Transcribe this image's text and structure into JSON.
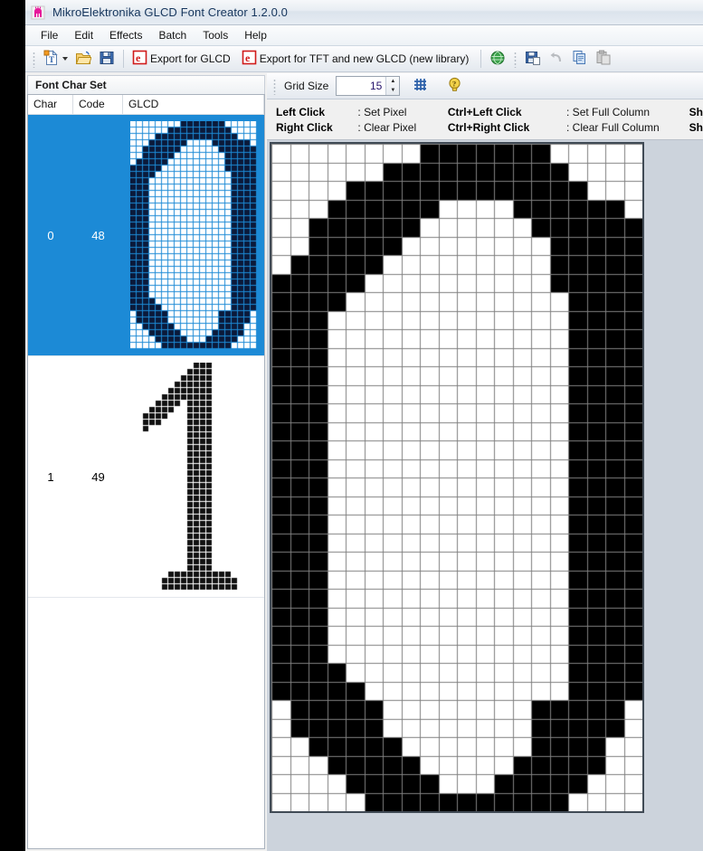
{
  "window": {
    "title": "MikroElektronika GLCD Font Creator 1.2.0.0",
    "app_icon": "app-logo-icon"
  },
  "menu": {
    "items": [
      {
        "label": "File"
      },
      {
        "label": "Edit"
      },
      {
        "label": "Effects"
      },
      {
        "label": "Batch"
      },
      {
        "label": "Tools"
      },
      {
        "label": "Help"
      }
    ]
  },
  "toolbar": {
    "new_label": "",
    "new_icon": "new-font-icon",
    "open_icon": "open-folder-icon",
    "save_icon": "save-disk-icon",
    "export_glcd_label": "Export for GLCD",
    "export_glcd_icon": "export-e-icon",
    "export_tft_label": "Export for TFT and new GLCD (new library)",
    "export_tft_icon": "export-e-icon",
    "web_icon": "globe-icon",
    "save_as_icon": "save-as-icon",
    "undo_icon": "undo-arrow-icon",
    "copy_icon": "copy-icon",
    "paste_icon": "paste-icon"
  },
  "left_panel": {
    "title": "Font Char Set",
    "columns": [
      "Char",
      "Code",
      "GLCD"
    ],
    "rows": [
      {
        "char": "0",
        "code": "48",
        "selected": true,
        "glyph": "zero"
      },
      {
        "char": "1",
        "code": "49",
        "selected": false,
        "glyph": "one"
      }
    ]
  },
  "grid_toolbar": {
    "label": "Grid Size",
    "value": "15",
    "spin_up_icon": "spinner-up-icon",
    "spin_down_icon": "spinner-down-icon",
    "toggle_grid_icon": "grid-toggle-icon",
    "help_icon": "help-bulb-icon"
  },
  "hints": {
    "rows": [
      {
        "key": "Left Click",
        "val": ": Set Pixel",
        "key2": "Ctrl+Left Click",
        "val2": ": Set Full Column",
        "key3": "Sh"
      },
      {
        "key": "Right Click",
        "val": ": Clear Pixel",
        "key2": "Ctrl+Right Click",
        "val2": ": Clear Full Column",
        "key3": "Sh"
      }
    ]
  },
  "editor": {
    "cols": 20,
    "rows": 36,
    "cell": 20.5,
    "on_color": "#000000",
    "off_color": "#ffffff",
    "line_color": "#808080",
    "border_color": "#404a55",
    "pixels": [
      "00000000111111100000",
      "00000011111111110000",
      "00001111111111111000",
      "00011111100001111110",
      "00111111000000111111",
      "00111110000000011111",
      "01111100000000011111",
      "11111000000000011111",
      "11110000000000001111",
      "11100000000000001111",
      "11100000000000001111",
      "11100000000000001111",
      "11100000000000001111",
      "11100000000000001111",
      "11100000000000001111",
      "11100000000000001111",
      "11100000000000001111",
      "11100000000000001111",
      "11100000000000001111",
      "11100000000000001111",
      "11100000000000001111",
      "11100000000000001111",
      "11100000000000001111",
      "11100000000000001111",
      "11100000000000001111",
      "11100000000000001111",
      "11100000000000001111",
      "11100000000000001111",
      "11110000000000001111",
      "11111000000000001111",
      "01111100000000111110",
      "01111100000000111110",
      "00111110000000111100",
      "00011111000001111100",
      "00001111100011111000",
      "00000111111111110000"
    ],
    "preview_zero": [
      "00000000111111100000",
      "00000011111111110000",
      "00001111111111111000",
      "00011111100001111110",
      "00111111000000111111",
      "00111110000000011111",
      "01111100000000011111",
      "11111000000000011111",
      "11110000000000001111",
      "11100000000000001111",
      "11100000000000001111",
      "11100000000000001111",
      "11100000000000001111",
      "11100000000000001111",
      "11100000000000001111",
      "11100000000000001111",
      "11100000000000001111",
      "11100000000000001111",
      "11100000000000001111",
      "11100000000000001111",
      "11100000000000001111",
      "11100000000000001111",
      "11100000000000001111",
      "11100000000000001111",
      "11100000000000001111",
      "11100000000000001111",
      "11100000000000001111",
      "11100000000000001111",
      "11110000000000001111",
      "11111000000000001111",
      "01111100000000111110",
      "01111100000000111110",
      "00111110000000111100",
      "00011111000001111100",
      "00001111100011111000",
      "00000111111111110000"
    ],
    "preview_one": [
      "00000000001110000000",
      "00000000011110000000",
      "00000000111110000000",
      "00000001111110000000",
      "00000011111110000000",
      "00000111111110000000",
      "00001111011110000000",
      "00011110011110000000",
      "00111100011110000000",
      "00111000011110000000",
      "00100000011110000000",
      "00000000011110000000",
      "00000000011110000000",
      "00000000011110000000",
      "00000000011110000000",
      "00000000011110000000",
      "00000000011110000000",
      "00000000011110000000",
      "00000000011110000000",
      "00000000011110000000",
      "00000000011110000000",
      "00000000011110000000",
      "00000000011110000000",
      "00000000011110000000",
      "00000000011110000000",
      "00000000011110000000",
      "00000000011110000000",
      "00000000011110000000",
      "00000000011110000000",
      "00000000011110000000",
      "00000000011110000000",
      "00000000011110000000",
      "00000000011110000000",
      "00000011111111110000",
      "00000111111111111000",
      "00000111111111111000"
    ]
  },
  "colors": {
    "selection_blue": "#1c8ad6",
    "title_text": "#15355c",
    "accent_magenta": "#e6199b"
  }
}
